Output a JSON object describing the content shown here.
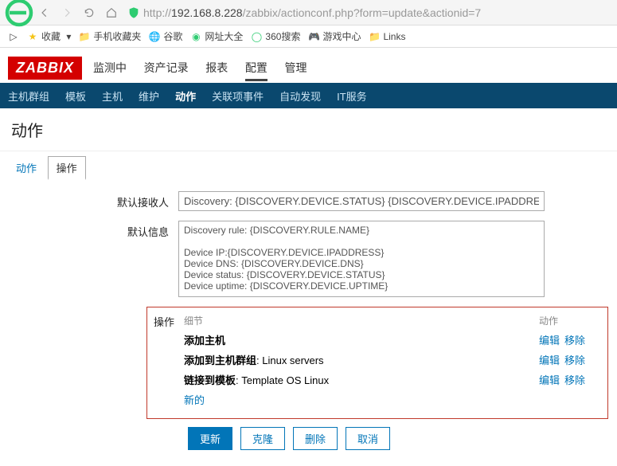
{
  "browser": {
    "url_prefix": "http://",
    "url_host": "192.168.8.228",
    "url_path": "/zabbix/actionconf.php?form=update&actionid=7"
  },
  "bookmarks": {
    "fav_label": "收藏",
    "items": [
      "手机收藏夹",
      "谷歌",
      "网址大全",
      "360搜索",
      "游戏中心",
      "Links"
    ]
  },
  "zabbix": {
    "logo": "ZABBIX",
    "top_nav": [
      "监测中",
      "资产记录",
      "报表",
      "配置",
      "管理"
    ],
    "top_nav_selected": 3,
    "sub_nav": [
      "主机群组",
      "模板",
      "主机",
      "维护",
      "动作",
      "关联项事件",
      "自动发现",
      "IT服务"
    ],
    "sub_nav_selected": 4,
    "page_title": "动作",
    "tabs": [
      "动作",
      "操作"
    ],
    "tabs_selected": 1
  },
  "form": {
    "recipient_label": "默认接收人",
    "recipient_value": "Discovery: {DISCOVERY.DEVICE.STATUS} {DISCOVERY.DEVICE.IPADDRESS}",
    "info_label": "默认信息",
    "info_value": "Discovery rule: {DISCOVERY.RULE.NAME}\n\nDevice IP:{DISCOVERY.DEVICE.IPADDRESS}\nDevice DNS: {DISCOVERY.DEVICE.DNS}\nDevice status: {DISCOVERY.DEVICE.STATUS}\nDevice uptime: {DISCOVERY.DEVICE.UPTIME}"
  },
  "ops": {
    "label": "操作",
    "col_detail": "细节",
    "col_action": "动作",
    "rows": [
      {
        "bold": "添加主机",
        "rest": ""
      },
      {
        "bold": "添加到主机群组",
        "rest": ": Linux servers"
      },
      {
        "bold": "链接到模板",
        "rest": ": Template OS Linux"
      }
    ],
    "edit": "编辑",
    "remove": "移除",
    "new": "新的"
  },
  "buttons": {
    "update": "更新",
    "clone": "克隆",
    "delete": "删除",
    "cancel": "取消"
  }
}
